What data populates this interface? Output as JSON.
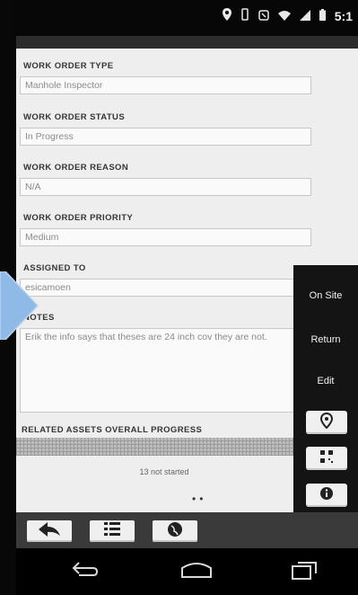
{
  "status_bar": {
    "icons": [
      "location-icon",
      "vibrate-icon",
      "nfc-icon",
      "wifi-icon",
      "signal-icon",
      "battery-icon"
    ],
    "time": "5:1"
  },
  "form": {
    "fields": [
      {
        "label": "WORK ORDER TYPE",
        "value": "Manhole Inspector"
      },
      {
        "label": "WORK ORDER STATUS",
        "value": "In Progress"
      },
      {
        "label": "WORK ORDER REASON",
        "value": "N/A"
      },
      {
        "label": "WORK ORDER PRIORITY",
        "value": "Medium"
      },
      {
        "label": "ASSIGNED TO",
        "value": "esicamoen"
      }
    ],
    "notes": {
      "label": "NOTES",
      "value": "Erik the info says that theses are 24 inch cov they are not."
    },
    "related_assets": {
      "label": "RELATED ASSETS OVERALL PROGRESS",
      "status_text": "13 not started",
      "progress_fraction": 0
    }
  },
  "side_menu": {
    "on_site": "On Site",
    "return": "Return",
    "edit": "Edit",
    "buttons": [
      "map-pin-icon",
      "qr-code-icon",
      "info-icon",
      "grid-menu-icon"
    ]
  },
  "toolbar": {
    "buttons": [
      "back-arrow-icon",
      "list-icon",
      "globe-icon"
    ]
  },
  "nav_bar": {
    "buttons": [
      "back-icon",
      "home-icon",
      "recents-icon"
    ]
  },
  "colors": {
    "panel_bg": "#eeeeee",
    "menu_bg": "#141414",
    "arrow_blue": "#8fb9e6"
  }
}
